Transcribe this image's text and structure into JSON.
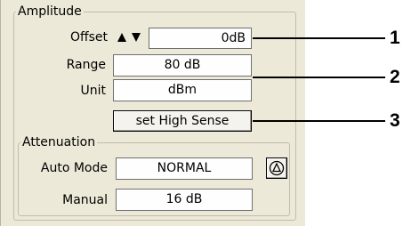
{
  "amplitude": {
    "title": "Amplitude",
    "offset": {
      "label": "Offset",
      "value": "0dB"
    },
    "range": {
      "label": "Range",
      "value": "80 dB"
    },
    "unit": {
      "label": "Unit",
      "value": "dBm"
    },
    "high_sense_button": "set High Sense"
  },
  "attenuation": {
    "title": "Attenuation",
    "auto_mode": {
      "label": "Auto Mode",
      "value": "NORMAL"
    },
    "manual": {
      "label": "Manual",
      "value": "16 dB"
    }
  },
  "callouts": [
    "1",
    "2",
    "3"
  ]
}
